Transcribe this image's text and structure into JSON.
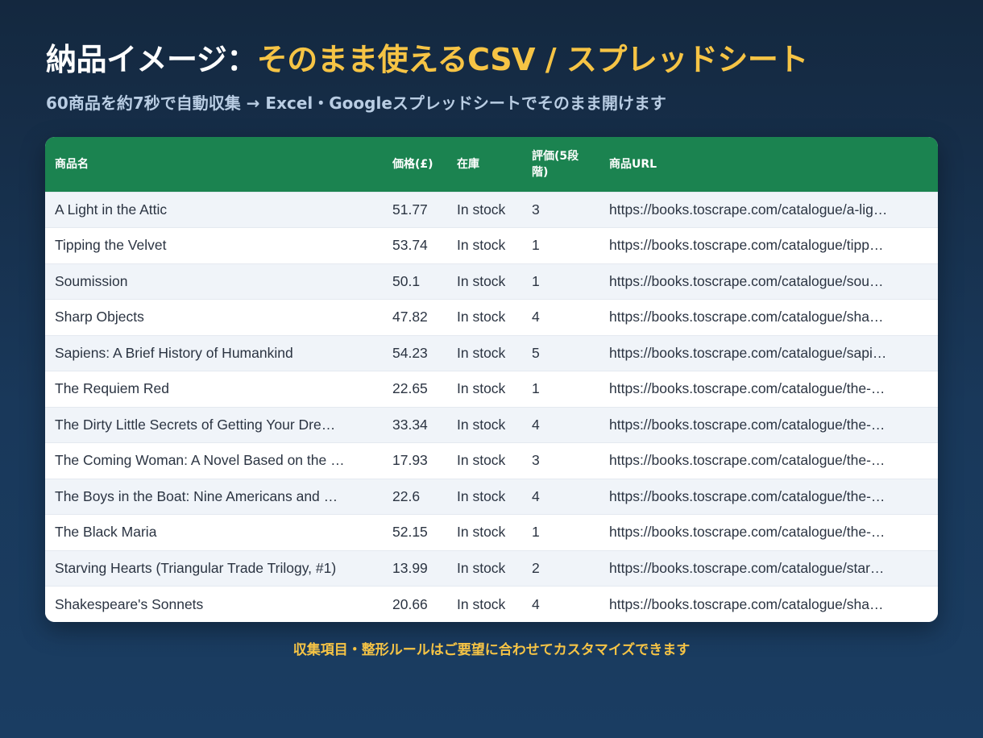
{
  "headline": {
    "lead": "納品イメージ：",
    "accent": "そのまま使えるCSV / スプレッドシート"
  },
  "subtitle": "60商品を約7秒で自動収集 → Excel・Googleスプレッドシートでそのまま開けます",
  "table": {
    "headers": {
      "name": "商品名",
      "price": "価格(£)",
      "stock": "在庫",
      "rating": "評価(5段階)",
      "url": "商品URL"
    },
    "rows": [
      {
        "name": "A Light in the Attic",
        "price": "51.77",
        "stock": "In stock",
        "rating": "3",
        "url": "https://books.toscrape.com/catalogue/a-lig…"
      },
      {
        "name": "Tipping the Velvet",
        "price": "53.74",
        "stock": "In stock",
        "rating": "1",
        "url": "https://books.toscrape.com/catalogue/tipp…"
      },
      {
        "name": "Soumission",
        "price": "50.1",
        "stock": "In stock",
        "rating": "1",
        "url": "https://books.toscrape.com/catalogue/sou…"
      },
      {
        "name": "Sharp Objects",
        "price": "47.82",
        "stock": "In stock",
        "rating": "4",
        "url": "https://books.toscrape.com/catalogue/sha…"
      },
      {
        "name": "Sapiens: A Brief History of Humankind",
        "price": "54.23",
        "stock": "In stock",
        "rating": "5",
        "url": "https://books.toscrape.com/catalogue/sapi…"
      },
      {
        "name": "The Requiem Red",
        "price": "22.65",
        "stock": "In stock",
        "rating": "1",
        "url": "https://books.toscrape.com/catalogue/the-…"
      },
      {
        "name": "The Dirty Little Secrets of Getting Your Dre…",
        "price": "33.34",
        "stock": "In stock",
        "rating": "4",
        "url": "https://books.toscrape.com/catalogue/the-…"
      },
      {
        "name": "The Coming Woman: A Novel Based on the …",
        "price": "17.93",
        "stock": "In stock",
        "rating": "3",
        "url": "https://books.toscrape.com/catalogue/the-…"
      },
      {
        "name": "The Boys in the Boat: Nine Americans and …",
        "price": "22.6",
        "stock": "In stock",
        "rating": "4",
        "url": "https://books.toscrape.com/catalogue/the-…"
      },
      {
        "name": "The Black Maria",
        "price": "52.15",
        "stock": "In stock",
        "rating": "1",
        "url": "https://books.toscrape.com/catalogue/the-…"
      },
      {
        "name": "Starving Hearts (Triangular Trade Trilogy, #1)",
        "price": "13.99",
        "stock": "In stock",
        "rating": "2",
        "url": "https://books.toscrape.com/catalogue/star…"
      },
      {
        "name": "Shakespeare's Sonnets",
        "price": "20.66",
        "stock": "In stock",
        "rating": "4",
        "url": "https://books.toscrape.com/catalogue/sha…"
      }
    ]
  },
  "footer_note": "収集項目・整形ルールはご要望に合わせてカスタマイズできます",
  "colors": {
    "accent": "#f6c445",
    "header_green": "#1b8350",
    "background": "#14283f"
  }
}
